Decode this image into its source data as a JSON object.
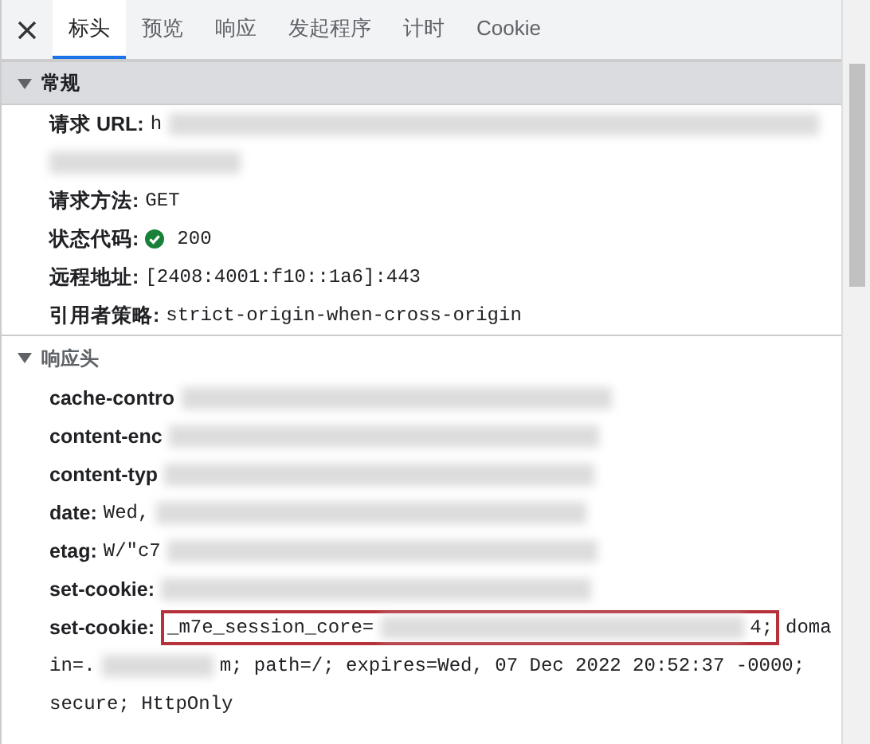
{
  "tabs": [
    {
      "label": "标头",
      "selected": true
    },
    {
      "label": "预览",
      "selected": false
    },
    {
      "label": "响应",
      "selected": false
    },
    {
      "label": "发起程序",
      "selected": false
    },
    {
      "label": "计时",
      "selected": false
    },
    {
      "label": "Cookie",
      "selected": false
    }
  ],
  "sections": [
    {
      "title": "常规",
      "expanded": true,
      "highlighted": true,
      "rows": [
        {
          "name": "请求 URL:",
          "lines": [
            [
              {
                "kind": "text",
                "text": "h"
              },
              {
                "kind": "blur"
              }
            ],
            [
              {
                "kind": "blur"
              }
            ]
          ]
        },
        {
          "name": "请求方法:",
          "lines": [
            [
              {
                "kind": "text",
                "text": "GET"
              }
            ]
          ]
        },
        {
          "name": "状态代码:",
          "lines": [
            [
              {
                "kind": "ok"
              },
              {
                "kind": "text",
                "text": "200"
              }
            ]
          ]
        },
        {
          "name": "远程地址:",
          "lines": [
            [
              {
                "kind": "text",
                "text": "[2408:4001:f10::1a6]:443"
              }
            ]
          ]
        },
        {
          "name": "引用者策略:",
          "lines": [
            [
              {
                "kind": "text",
                "text": "strict-origin-when-cross-origin"
              }
            ]
          ]
        }
      ]
    },
    {
      "title": "响应头",
      "expanded": true,
      "highlighted": false,
      "rows": [
        {
          "name": "cache-contro",
          "lines": [
            [
              {
                "kind": "blur"
              }
            ]
          ]
        },
        {
          "name": "content-enc",
          "lines": [
            [
              {
                "kind": "blur"
              }
            ]
          ]
        },
        {
          "name": "content-typ",
          "lines": [
            [
              {
                "kind": "blur"
              }
            ]
          ]
        },
        {
          "name": "date:",
          "lines": [
            [
              {
                "kind": "text",
                "text": "Wed,"
              },
              {
                "kind": "blur"
              }
            ]
          ]
        },
        {
          "name": "etag:",
          "lines": [
            [
              {
                "kind": "text",
                "text": "W/\"c7"
              },
              {
                "kind": "blur"
              }
            ]
          ]
        },
        {
          "name": "set-cookie:",
          "lines": [
            [
              {
                "kind": "blur"
              }
            ]
          ]
        },
        {
          "name": "set-cookie:",
          "lines": [
            [
              {
                "kind": "box",
                "parts": [
                  {
                    "kind": "text",
                    "text": "_m7e_session_core="
                  },
                  {
                    "kind": "blur"
                  },
                  {
                    "kind": "text",
                    "text": "4;"
                  }
                ]
              },
              {
                "kind": "text",
                "text": "doma"
              }
            ],
            [
              {
                "kind": "text",
                "text": "in=."
              },
              {
                "kind": "blur"
              },
              {
                "kind": "text",
                "text": "m; path=/; expires=Wed, 07 Dec 2022 20:52:37 -0000;"
              }
            ],
            [
              {
                "kind": "text",
                "text": "secure; HttpOnly"
              }
            ]
          ]
        }
      ]
    }
  ]
}
